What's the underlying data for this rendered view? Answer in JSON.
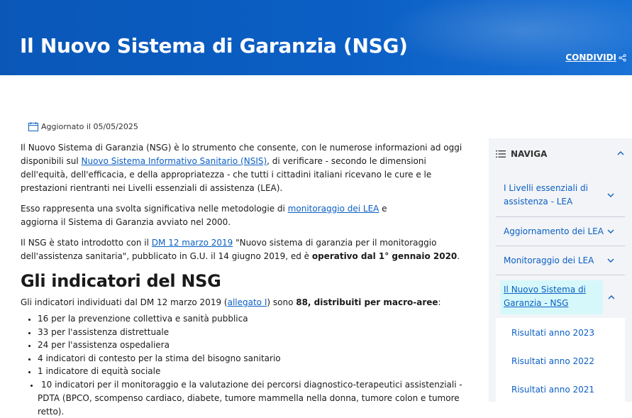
{
  "hero": {
    "title": "Il Nuovo Sistema di Garanzia (NSG)",
    "share_label": "CONDIVIDI"
  },
  "updated": "Aggiornato il 05/05/2025",
  "intro": {
    "p1_a": "Il Nuovo Sistema di Garanzia (NSG) è lo strumento che consente, con le numerose informazioni ad oggi disponibili sul ",
    "p1_link": "Nuovo Sistema Informativo Sanitario (NSIS)",
    "p1_b": ", di verificare - secondo le dimensioni dell'equità, dell'efficacia, e della appropriatezza - che tutti i cittadini italiani ricevano le cure e le prestazioni rientranti nei Livelli essenziali di assistenza (LEA).",
    "p2_a": "Esso rappresenta una svolta significativa nelle metodologie di ",
    "p2_link": "monitoraggio dei LEA",
    "p2_b": " e aggiorna il Sistema di Garanzia avviato nel 2000.",
    "p3_a": "Il NSG è stato introdotto con il ",
    "p3_link": "DM 12 marzo 2019",
    "p3_b": " \"Nuovo sistema di garanzia per il monitoraggio dell'assistenza sanitaria\", pubblicato in G.U. il 14 giugno 2019, ed è ",
    "p3_bold": "operativo dal 1° gennaio 2020",
    "p3_c": "."
  },
  "indicators": {
    "heading": "Gli indicatori del NSG",
    "lead_a": "Gli indicatori individuati dal DM 12 marzo 2019 (",
    "lead_link": "allegato I",
    "lead_b": ") sono ",
    "lead_bold": "88, distribuiti per macro-aree",
    "lead_c": ":",
    "items": [
      "16 per la prevenzione collettiva e sanità pubblica",
      "33 per l'assistenza distrettuale",
      "24 per l'assistenza ospedaliera",
      "4 indicatori di contesto per la stima del bisogno sanitario",
      "1 indicatore di equità sociale",
      "10 indicatori per il monitoraggio e la valutazione dei percorsi diagnostico-terapeutici assistenziali - PDTA (BPCO, scompenso cardiaco, diabete, tumore mammella nella donna, tumore colon e tumore retto)."
    ]
  },
  "nav": {
    "title": "NAVIGA",
    "items": [
      "I Livelli essenziali di assistenza - LEA",
      "Aggiornamento dei LEA",
      "Monitoraggio dei LEA",
      "Il Nuovo Sistema di Garanzia - NSG"
    ],
    "subitems": [
      "Risultati anno 2023",
      "Risultati anno 2022",
      "Risultati anno 2021"
    ]
  },
  "colors": {
    "brand": "#0b5fc4",
    "active_bg": "#d6f8fb",
    "nav_bg": "#f2f4f7"
  }
}
